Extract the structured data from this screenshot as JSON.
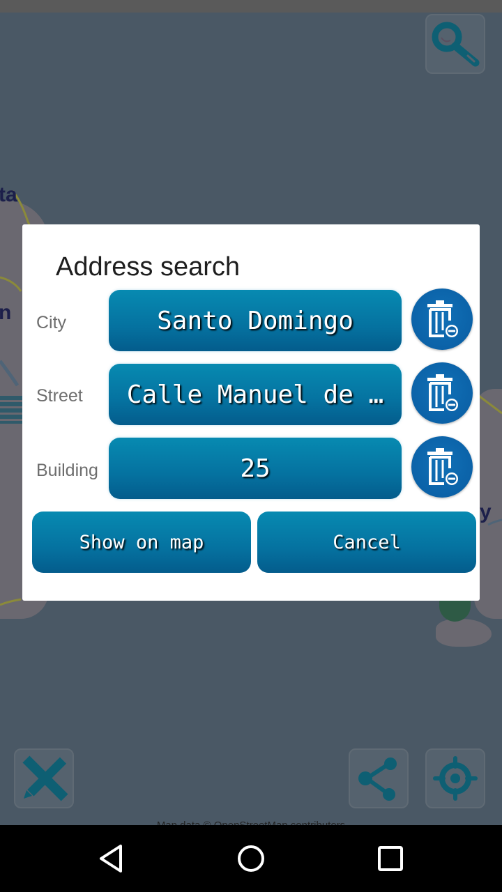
{
  "map": {
    "labels": [
      "ta",
      "n",
      "y"
    ],
    "attribution": "Map data © OpenStreetMap contributors",
    "buttons": {
      "search": "search-icon",
      "measure": "ruler-pencil-icon",
      "share": "share-icon",
      "locate": "locate-icon"
    }
  },
  "dialog": {
    "title": "Address search",
    "fields": [
      {
        "label": "City",
        "value": "Santo Domingo",
        "clear_icon": "trash-icon"
      },
      {
        "label": "Street",
        "value": "Calle Manuel de …",
        "clear_icon": "trash-icon"
      },
      {
        "label": "Building",
        "value": "25",
        "clear_icon": "trash-icon"
      }
    ],
    "show_on_map_label": "Show on map",
    "cancel_label": "Cancel"
  },
  "navbar": {
    "back": "back-icon",
    "home": "home-icon",
    "recents": "recents-icon"
  },
  "colors": {
    "button_top": "#078ab1",
    "button_bottom": "#045c8c",
    "trash_bg": "#0b62a8",
    "map_overlay": "#4a5865",
    "icon_teal": "#0e5f73"
  }
}
